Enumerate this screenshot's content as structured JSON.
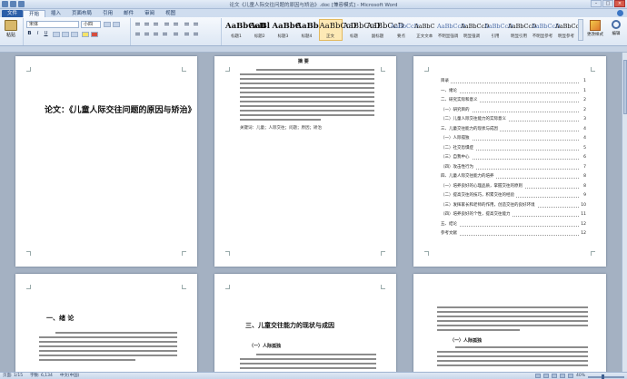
{
  "window": {
    "title": "论文《儿童人际交往问题的原因与矫治》.doc [兼容模式] - Microsoft Word"
  },
  "tabs": [
    "开始",
    "插入",
    "页面布局",
    "引用",
    "邮件",
    "审阅",
    "视图"
  ],
  "tab_file": "文件",
  "ribbon": {
    "paste_label": "粘贴",
    "font_name": "宋体",
    "font_size": "小四",
    "format_buttons": [
      "B",
      "I",
      "U"
    ],
    "styles": [
      {
        "sample": "AaBbCcD",
        "name": "标题1"
      },
      {
        "sample": "AaBl",
        "name": "标题2"
      },
      {
        "sample": "AaBbC",
        "name": "标题3"
      },
      {
        "sample": "AaBbC",
        "name": "标题4"
      },
      {
        "sample": "AaBbCcD",
        "name": "正文"
      },
      {
        "sample": "AaBbCcD",
        "name": "标题"
      },
      {
        "sample": "AaBbCcD",
        "name": "副标题"
      },
      {
        "sample": "AaBbCcD",
        "name": "要点"
      },
      {
        "sample": "AaBbC",
        "name": "正文文本"
      },
      {
        "sample": "AaBbCcD",
        "name": "不明显强调"
      },
      {
        "sample": "AaBbCcD",
        "name": "明显强调"
      },
      {
        "sample": "AaBbCcD",
        "name": "引用"
      },
      {
        "sample": "AaBbCcD",
        "name": "明显引用"
      },
      {
        "sample": "AaBbCcD",
        "name": "不明显参考"
      },
      {
        "sample": "AaBbCcD",
        "name": "明显参考"
      }
    ],
    "change_styles": "更改样式",
    "editing": "编辑"
  },
  "pages": {
    "p1": {
      "title": "论文：《儿童人际交往问题的原因与矫治》"
    },
    "p2": {
      "heading": "摘 要",
      "keywords": "关键词：儿童；人际交往；问题；原因；矫治"
    },
    "p3": {
      "toc": [
        {
          "text": "目录",
          "page": "1"
        },
        {
          "text": "一、绪论",
          "page": "1"
        },
        {
          "text": "二、研究实际和意义",
          "page": "2"
        },
        {
          "text": "（一）研究目的",
          "page": "2"
        },
        {
          "text": "（二）儿童人际交往能力的实际意义",
          "page": "3"
        },
        {
          "text": "三、儿童交往能力的现状与成因",
          "page": "4"
        },
        {
          "text": "（一）人际孤独",
          "page": "4"
        },
        {
          "text": "（二）社交恐惧症",
          "page": "5"
        },
        {
          "text": "（三）自我中心",
          "page": "6"
        },
        {
          "text": "（四）攻击性行为",
          "page": "7"
        },
        {
          "text": "四、儿童人际交往能力的培养",
          "page": "8"
        },
        {
          "text": "（一）培养良好的心理品质，掌握交往的原则",
          "page": "8"
        },
        {
          "text": "（二）提高交往的技巧，积累交往的经验",
          "page": "9"
        },
        {
          "text": "（三）发挥家长和老师的作用，创造交往的良好环境",
          "page": "10"
        },
        {
          "text": "（四）培养良好的个性，提高交往能力",
          "page": "11"
        },
        {
          "text": "五、结论",
          "page": "12"
        },
        {
          "text": "参考文献",
          "page": "12"
        }
      ]
    },
    "p4": {
      "heading": "一、绪 论"
    },
    "p5": {
      "heading": "三、儿童交往能力的现状与成因",
      "subheading": "（一）人际孤独"
    },
    "p6": {
      "subheading": "（一）人际孤独"
    }
  },
  "status": {
    "page": "页面: 1/15",
    "words": "字数: 6,134",
    "language": "中文(中国)",
    "zoom": "40%",
    "zoom_fraction": 0.4
  }
}
